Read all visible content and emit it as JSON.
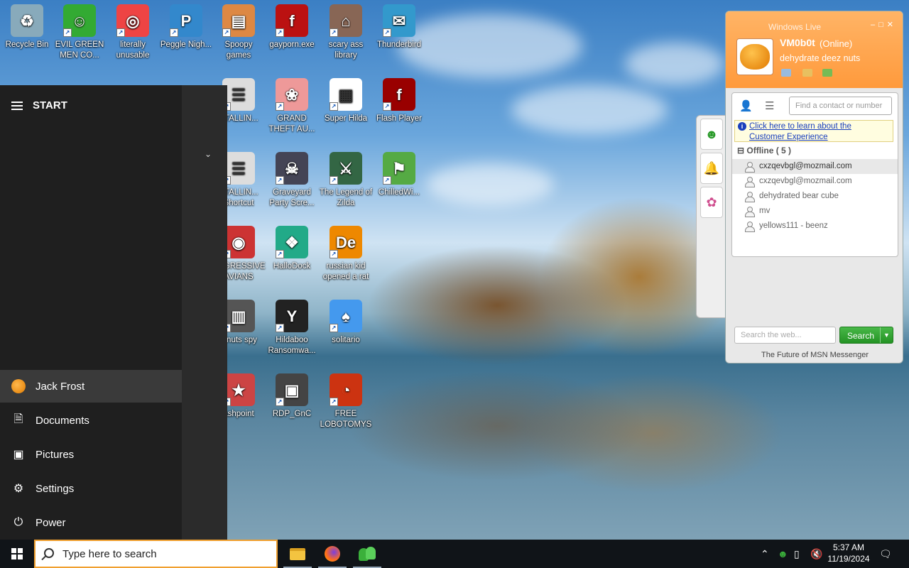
{
  "desktop": {
    "icons": [
      {
        "label": "Recycle Bin",
        "icon": "recycle-bin-icon"
      },
      {
        "label": "EVIL GREEN MEN CO...",
        "icon": "msn-men-icon"
      },
      {
        "label": "literally unusable",
        "icon": "chrome-icon"
      },
      {
        "label": "Peggle Nigh...",
        "icon": "peggle-icon"
      },
      {
        "label": "Spoopy games",
        "icon": "folder-icon"
      },
      {
        "label": "gayporn.exe",
        "icon": "flash-icon"
      },
      {
        "label": "scary ass library",
        "icon": "library-shield-icon"
      },
      {
        "label": "Thunderbird",
        "icon": "thunderbird-icon"
      },
      {
        "label": "STALLIN...",
        "icon": "document-icon"
      },
      {
        "label": "GRAND THEFT AU...",
        "icon": "anime-girl-icon"
      },
      {
        "label": "Super Hilda",
        "icon": "pixel-cat-icon"
      },
      {
        "label": "Flash Player",
        "icon": "flash-icon"
      },
      {
        "label": "STALLIN... Shortcut",
        "icon": "document-icon"
      },
      {
        "label": "Graveyard Party Scre...",
        "icon": "graveyard-icon"
      },
      {
        "label": "The Legend of Zilda",
        "icon": "zilda-icon"
      },
      {
        "label": "ChilledWi...",
        "icon": "windows-flag-icon"
      },
      {
        "label": "AGGRESSIVE AVIANS",
        "icon": "angry-bird-icon"
      },
      {
        "label": "HalloDock",
        "icon": "shield-icon"
      },
      {
        "label": "russian kid opened a rat",
        "icon": "de-icon"
      },
      {
        "label": "z nuts spy",
        "icon": "windows-stack-icon"
      },
      {
        "label": "Hildaboo Ransomwa...",
        "icon": "yashma-icon"
      },
      {
        "label": "solitario",
        "icon": "solitaire-icon"
      },
      {
        "label": "ashpoint",
        "icon": "star-icon"
      },
      {
        "label": "RDP_GnC",
        "icon": "rdp-icon"
      },
      {
        "label": "FREE LOBOTOMYS",
        "icon": "gauge-icon"
      }
    ]
  },
  "start_menu": {
    "title": "START",
    "items": [
      {
        "label": "Jack Frost",
        "icon": "user-avatar-icon"
      },
      {
        "label": "Documents",
        "icon": "document-icon"
      },
      {
        "label": "Pictures",
        "icon": "pictures-icon"
      },
      {
        "label": "Settings",
        "icon": "gear-icon"
      },
      {
        "label": "Power",
        "icon": "power-icon"
      }
    ]
  },
  "msn": {
    "title": "Windows Live",
    "user_name": "VM0b0t",
    "status": "(Online)",
    "personal_message": "dehydrate deez nuts",
    "find_placeholder": "Find a contact or number",
    "info_link": "Click here to learn about the Customer Experience",
    "group": "Offline ( 5 )",
    "contacts": [
      "cxzqevbgl@mozmail.com",
      "cxzqevbgl@mozmail.com",
      "dehydrated bear cube",
      "mv",
      "yellows111 - beenz"
    ],
    "search_placeholder": "Search the web...",
    "search_button": "Search",
    "footer": "The Future of MSN Messenger"
  },
  "taskbar": {
    "search_placeholder": "Type here to search",
    "time": "5:37 AM",
    "date": "11/19/2024"
  }
}
